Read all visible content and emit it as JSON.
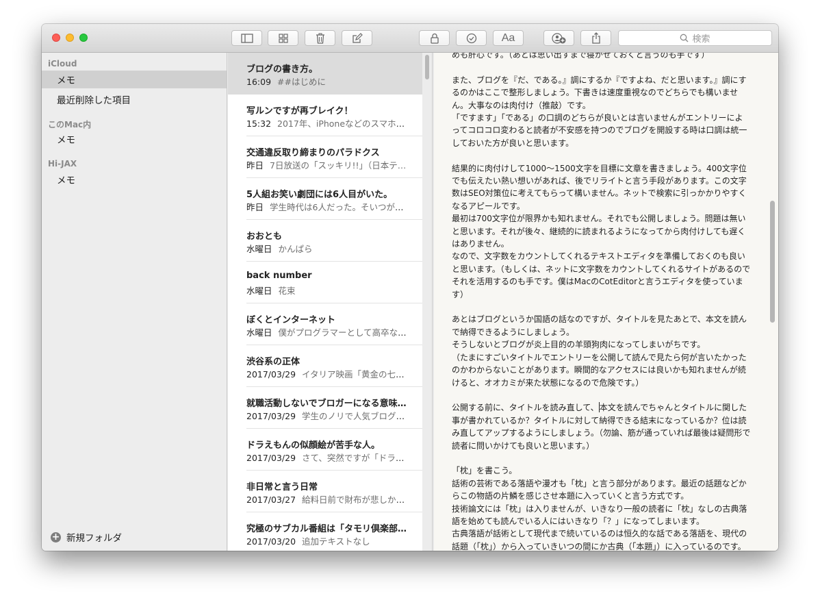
{
  "toolbar": {
    "font_label": "Aa",
    "search_placeholder": "検索"
  },
  "sidebar": {
    "accounts": [
      {
        "name": "iCloud",
        "folders": [
          "メモ",
          "最近削除した項目"
        ]
      },
      {
        "name": "このMac内",
        "folders": [
          "メモ"
        ]
      },
      {
        "name": "Hi-JAX",
        "folders": [
          "メモ"
        ]
      }
    ],
    "new_folder_label": "新規フォルダ"
  },
  "notes": [
    {
      "title": "ブログの書き方。",
      "date": "16:09",
      "snippet": "##はじめに"
    },
    {
      "title": "写ルンですが再ブレイク！",
      "date": "15:32",
      "snippet": "2017年、iPhoneなどのスマホで…"
    },
    {
      "title": "交通違反取り締まりのパラドクス",
      "date": "昨日",
      "snippet": "7日放送の「スッキリ!!」（日本テ…"
    },
    {
      "title": "5人組お笑い劇団には6人目がいた。",
      "date": "昨日",
      "snippet": "学生時代は6人だった。そいつが脚…"
    },
    {
      "title": "おおとも",
      "date": "水曜日",
      "snippet": "かんぱら"
    },
    {
      "title": "back number",
      "date": "水曜日",
      "snippet": "花束"
    },
    {
      "title": "ぼくとインターネット",
      "date": "水曜日",
      "snippet": "僕がプログラマーとして高卒なが…"
    },
    {
      "title": "渋谷系の正体",
      "date": "2017/03/29",
      "snippet": "イタリア映画「黄金の七人…"
    },
    {
      "title": "就職活動しないでブロガーになる意味…",
      "date": "2017/03/29",
      "snippet": "学生のノリで人気ブログを…"
    },
    {
      "title": "ドラえもんの似顔絵が苦手な人。",
      "date": "2017/03/29",
      "snippet": "さて、突然ですが「ドラえ…"
    },
    {
      "title": "非日常と言う日常",
      "date": "2017/03/27",
      "snippet": "給料日前で財布が悲しかっ…"
    },
    {
      "title": "究極のサブカル番組は「タモリ倶楽部…",
      "date": "2017/03/20",
      "snippet": "追加テキストなし"
    }
  ],
  "editor": {
    "lines": [
      "めも肝心です。（あとは思い出すまで寝かせておくと言うのも手です）",
      "",
      "また、ブログを『だ、である。』調にするか『ですよね、だと思います。』調にするのかはここで整形しましょう。下書きは速度重視なのでどちらでも構いません。大事なのは肉付け（推敲）です。",
      "「ですます」「である」の口調のどちらが良いとは言いませんがエントリーによってコロコロ変わると読者が不安感を持つのでブログを開設する時は口調は統一しておいた方が良いと思います。",
      "",
      "結果的に肉付けして1000〜1500文字を目標に文章を書きましょう。400文字位でも伝えたい熱い想いがあれば、後でリライトと言う手段があります。この文字数はSEO対策位に考えてもらって構いません。ネットで検索に引っかかりやすくなるアピールです。",
      "最初は700文字位が限界かも知れません。それでも公開しましょう。問題は無いと思います。それが後々、継続的に読まれるようになってから肉付けしても遅くはありません。",
      "なので、文字数をカウントしてくれるテキストエディタを準備しておくのも良いと思います。（もしくは、ネットに文字数をカウントしてくれるサイトがあるのでそれを活用するのも手です。僕はMacのCotEditorと言うエディタを使っています）",
      "",
      "あとはブログというか国語の話なのですが、タイトルを見たあとで、本文を読んで納得できるようにしましょう。",
      "そうしないとブログが炎上目的の羊頭狗肉になってしまいがちです。",
      "（たまにすごいタイトルでエントリーを公開して読んで見たら何が言いたかったのかわからないことがあります。瞬間的なアクセスには良いかも知れませんが続けると、オオカミが来た状態になるので危険です。）",
      "",
      "公開する前に、タイトルを読み直して、",
      "本文を読んでちゃんとタイトルに関した事が書かれているか？タイトルに対して納得できる結末になっているか？位は読み直してアップするようにしましょう。（勿論、筋が通っていれば最後は疑問形で読者に問いかけても良いと思います。）",
      "",
      "「枕」を書こう。",
      "話術の芸術である落語や漫才も「枕」と言う部分があります。最近の話題などからこの物語の片鱗を感じさせ本題に入っていくと言う方式です。",
      "技術論文には「枕」は入りませんが、いきなり一般の読者に「枕」なしの古典落語を始めても読んでいる人にはいきなり「？」になってしまいます。",
      "古典落語が話術として現代まで続いているのは恒久的な話である落語を、現代の話題（「枕」）から入っていきいつの間にか古典（「本題」）に入っているのです。"
    ]
  }
}
